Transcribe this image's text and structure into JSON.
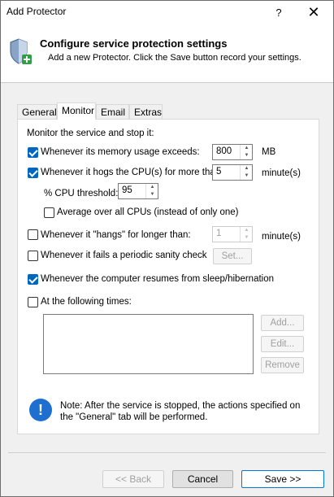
{
  "window": {
    "title": "Add Protector",
    "help_label": "?",
    "close_label": "✕"
  },
  "header": {
    "title": "Configure service protection settings",
    "subtitle": "Add a new Protector. Click the Save button record your settings.",
    "icon": "shield-plus-icon"
  },
  "tabs": [
    {
      "label": "General",
      "active": false
    },
    {
      "label": "Monitor",
      "active": true
    },
    {
      "label": "Email",
      "active": false
    },
    {
      "label": "Extras",
      "active": false
    }
  ],
  "monitor": {
    "section_label": "Monitor the service and stop it:",
    "memory": {
      "checked": true,
      "label": "Whenever its memory usage exceeds:",
      "value": "800",
      "unit": "MB"
    },
    "cpu": {
      "checked": true,
      "label": "Whenever it hogs the CPU(s) for more than:",
      "value": "5",
      "unit": "minute(s)"
    },
    "cpu_threshold": {
      "label": "% CPU threshold:",
      "value": "95"
    },
    "average_cpus": {
      "checked": false,
      "label": "Average over all CPUs (instead of only one)"
    },
    "hangs": {
      "checked": false,
      "label": "Whenever it \"hangs\" for longer than:",
      "value": "1",
      "unit": "minute(s)"
    },
    "sanity": {
      "checked": false,
      "label": "Whenever it fails a periodic sanity check",
      "button": "Set..."
    },
    "resume": {
      "checked": true,
      "label": "Whenever the computer resumes from sleep/hibernation"
    },
    "times": {
      "checked": false,
      "label": "At the following times:",
      "add": "Add...",
      "edit": "Edit...",
      "remove": "Remove"
    }
  },
  "note": {
    "icon": "info-icon",
    "text": "Note: After the service is stopped, the actions specified on the \"General\" tab will be performed."
  },
  "footer": {
    "back": "<< Back",
    "cancel": "Cancel",
    "save": "Save >>"
  },
  "colors": {
    "accent": "#0067c0",
    "info": "#1e6fd0"
  }
}
